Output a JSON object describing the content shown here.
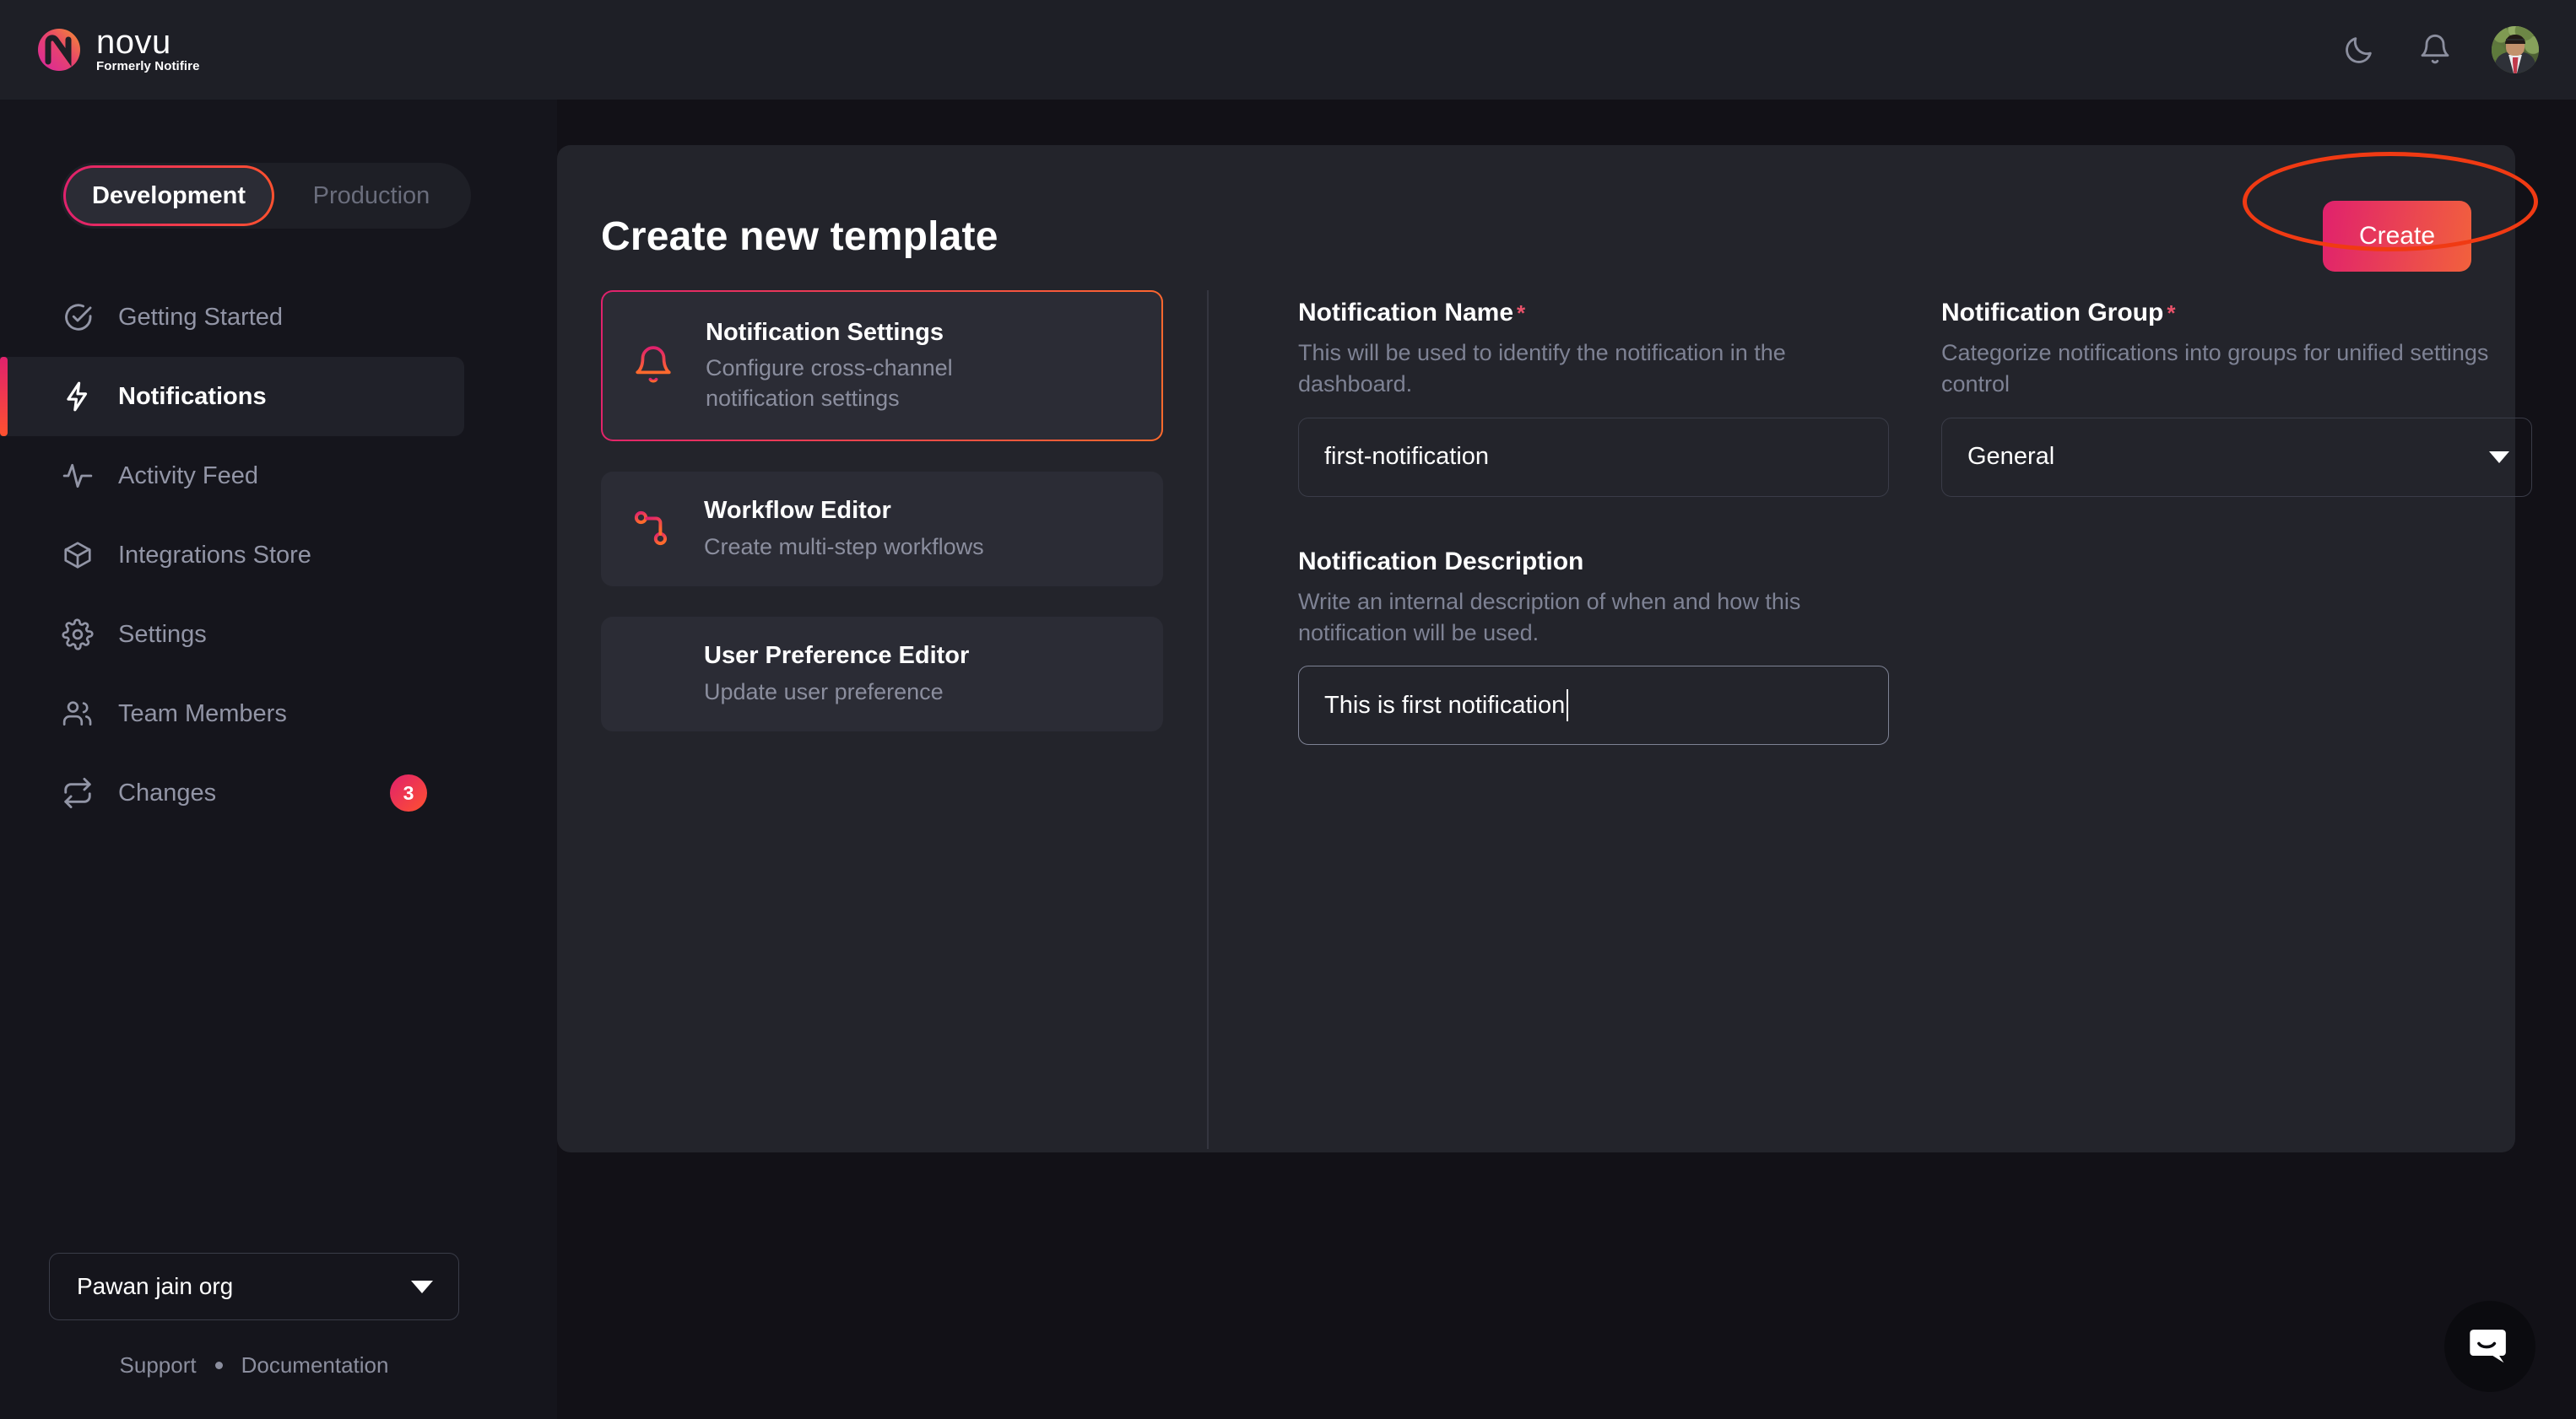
{
  "header": {
    "brand_word": "novu",
    "brand_sub": "Formerly Notifire",
    "theme_toggle_icon": "moon-icon",
    "notifications_icon": "bell-icon",
    "avatar_alt": "user-avatar"
  },
  "sidebar": {
    "env_toggle": {
      "active": "Development",
      "inactive": "Production"
    },
    "items": [
      {
        "label": "Getting Started",
        "icon": "circle-check-icon",
        "active": false,
        "badge": null
      },
      {
        "label": "Notifications",
        "icon": "bolt-icon",
        "active": true,
        "badge": null
      },
      {
        "label": "Activity Feed",
        "icon": "activity-pulse-icon",
        "active": false,
        "badge": null
      },
      {
        "label": "Integrations Store",
        "icon": "cube-icon",
        "active": false,
        "badge": null
      },
      {
        "label": "Settings",
        "icon": "gear-icon",
        "active": false,
        "badge": null
      },
      {
        "label": "Team Members",
        "icon": "users-icon",
        "active": false,
        "badge": null
      },
      {
        "label": "Changes",
        "icon": "repeat-icon",
        "active": false,
        "badge": "3"
      }
    ],
    "org_select": {
      "value": "Pawan jain org",
      "caret_icon": "chevron-down-icon"
    },
    "footer": {
      "support": "Support",
      "documentation": "Documentation"
    }
  },
  "main": {
    "title": "Create new template",
    "create_button": "Create",
    "cards": [
      {
        "title": "Notification Settings",
        "desc": "Configure cross-channel notification settings",
        "icon": "bell-icon",
        "active": true
      },
      {
        "title": "Workflow Editor",
        "desc": "Create multi-step workflows",
        "icon": "git-branch-icon",
        "active": false
      },
      {
        "title": "User Preference Editor",
        "desc": "Update user preference",
        "icon": "sliders-icon",
        "active": false
      }
    ],
    "fields": {
      "notification_name": {
        "label": "Notification Name",
        "required_marker": "*",
        "help": "This will be used to identify the notification in the dashboard.",
        "value": "first-notification"
      },
      "notification_description": {
        "label": "Notification Description",
        "required_marker": "",
        "help": "Write an internal description of when and how this notification will be used.",
        "value": "This is first notification",
        "focused": true
      },
      "notification_group": {
        "label": "Notification Group",
        "required_marker": "*",
        "help": "Categorize notifications into groups for unified settings control",
        "value": "General",
        "caret_icon": "chevron-down-icon"
      }
    }
  },
  "chat": {
    "icon": "intercom-chat-icon"
  },
  "annotation": {
    "shape": "ellipse-highlight",
    "color": "#f03a13",
    "targets": "create-button"
  },
  "colors": {
    "page_bg": "#121117",
    "topbar_bg": "#1e1f26",
    "sidebar_bg": "#15151c",
    "panel_bg": "#23242b",
    "card_bg": "#2b2c35",
    "accent_pink": "#e0216d",
    "accent_orange": "#ff512f",
    "text_muted": "#8b8e9e",
    "required_red": "#e9536b"
  }
}
